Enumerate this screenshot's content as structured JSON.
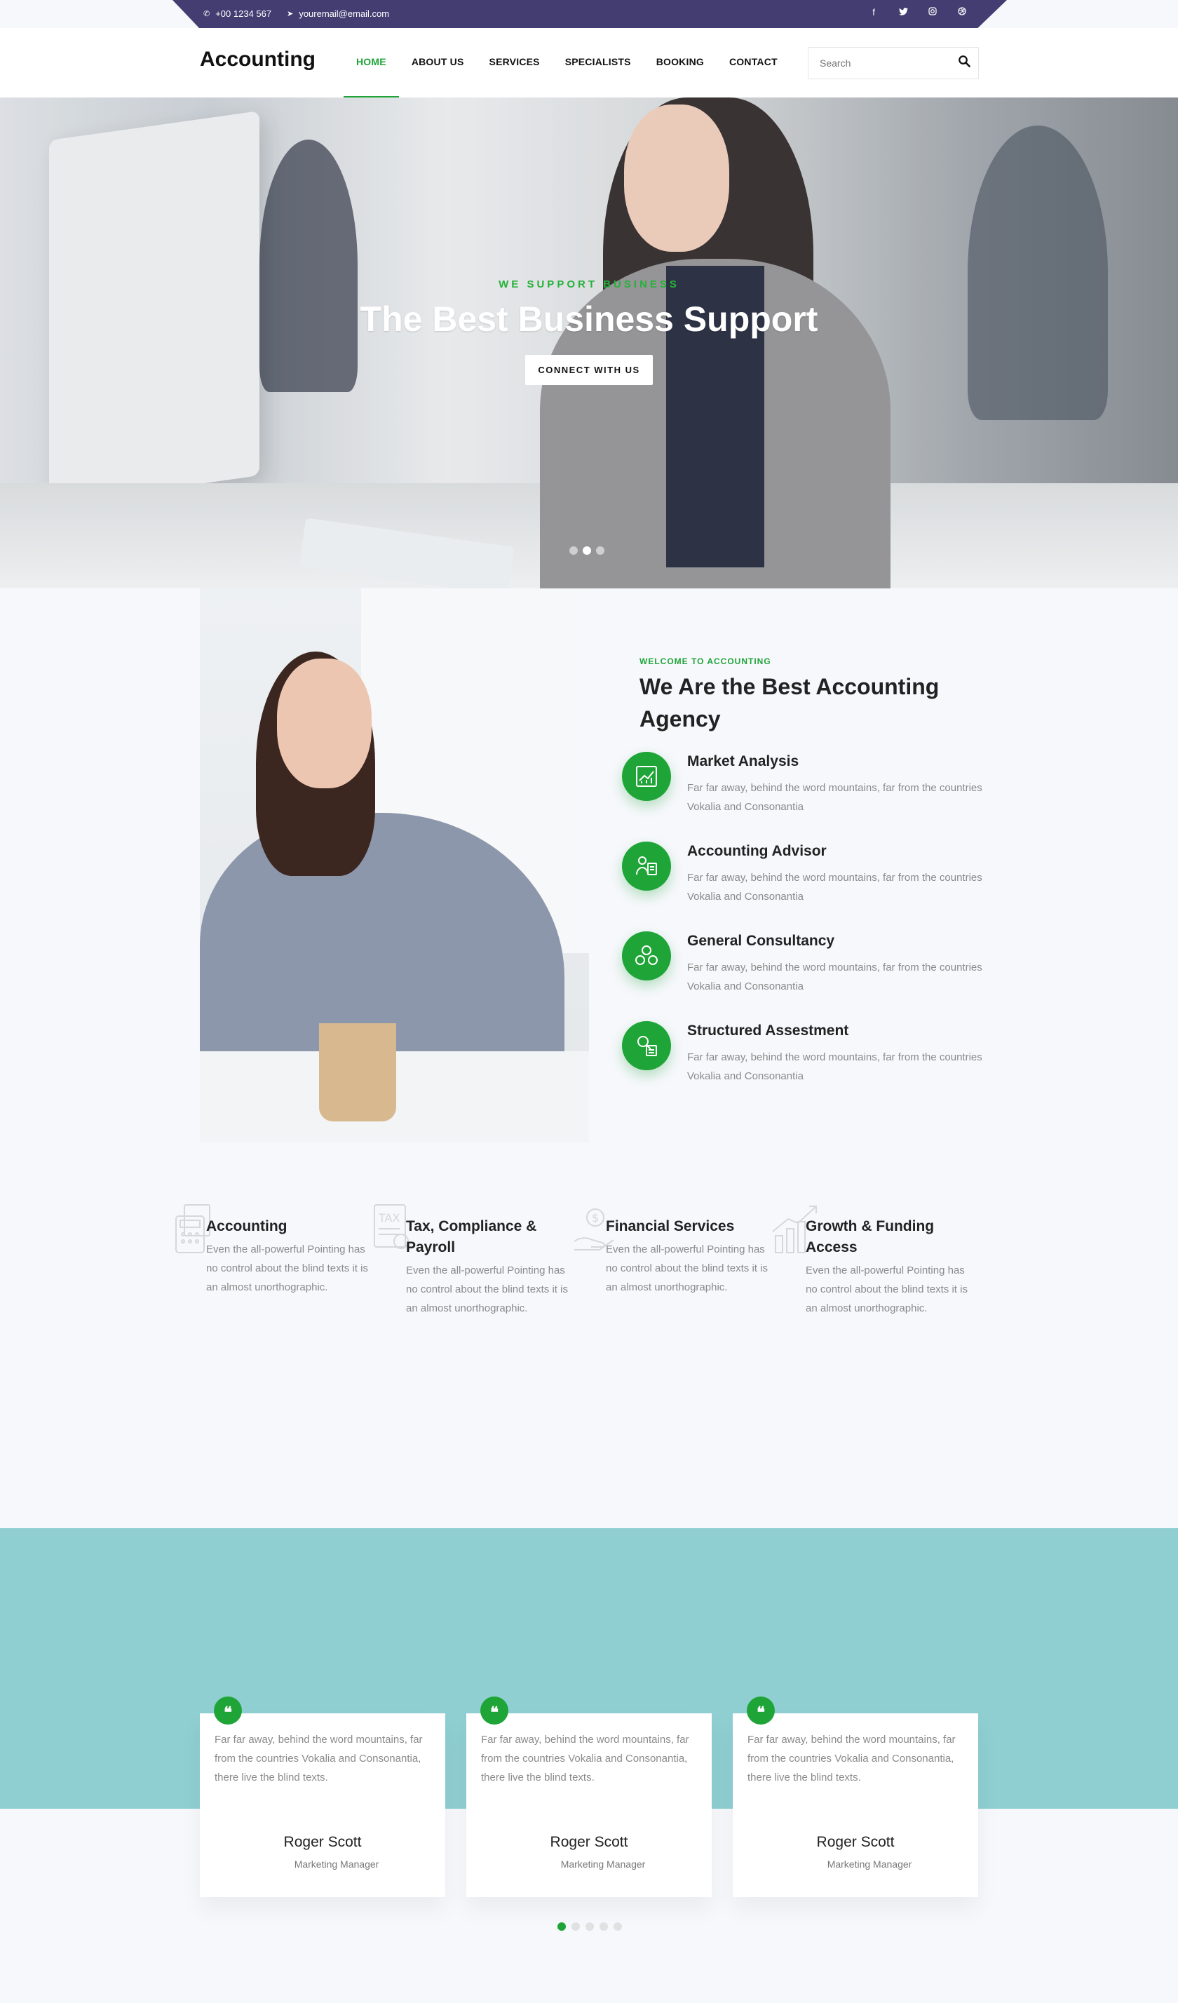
{
  "topbar": {
    "phone": "+00 1234 567",
    "email": "youremail@email.com",
    "social": [
      "f",
      "t",
      "ig",
      "dr"
    ]
  },
  "nav": {
    "brand": "Accounting",
    "items": [
      "HOME",
      "ABOUT US",
      "SERVICES",
      "SPECIALISTS",
      "BOOKING",
      "CONTACT"
    ],
    "active": "HOME",
    "search_placeholder": "Search"
  },
  "hero": {
    "kicker": "WE SUPPORT BUSINESS",
    "title": "The Best Business Support",
    "cta": "CONNECT WITH US",
    "slides": 3,
    "active_slide": 2
  },
  "about": {
    "kicker": "WELCOME TO ACCOUNTING",
    "title": "We Are the Best Accounting Agency",
    "features": [
      {
        "title": "Market Analysis",
        "icon": "chart-growth-icon",
        "text": "Far far away, behind the word mountains, far from the countries Vokalia and Consonantia"
      },
      {
        "title": "Accounting Advisor",
        "icon": "advisor-icon",
        "text": "Far far away, behind the word mountains, far from the countries Vokalia and Consonantia"
      },
      {
        "title": "General Consultancy",
        "icon": "team-icon",
        "text": "Far far away, behind the word mountains, far from the countries Vokalia and Consonantia"
      },
      {
        "title": "Structured Assestment",
        "icon": "assessment-icon",
        "text": "Far far away, behind the word mountains, far from the countries Vokalia and Consonantia"
      }
    ]
  },
  "services": [
    {
      "title": "Accounting",
      "icon": "calculator-icon",
      "text": "Even the all-powerful Pointing has no control about the blind texts it is an almost unorthographic."
    },
    {
      "title": "Tax, Compliance & Payroll",
      "icon": "tax-document-icon",
      "text": "Even the all-powerful Pointing has no control about the blind texts it is an almost unorthographic."
    },
    {
      "title": "Financial Services",
      "icon": "money-hand-icon",
      "text": "Even the all-powerful Pointing has no control about the blind texts it is an almost unorthographic."
    },
    {
      "title": "Growth & Funding Access",
      "icon": "growth-chart-icon",
      "text": "Even the all-powerful Pointing has no control about the blind texts it is an almost unorthographic."
    }
  ],
  "testimonials": {
    "items": [
      {
        "text": "Far far away, behind the word mountains, far from the countries Vokalia and Consonantia, there live the blind texts.",
        "name": "Roger Scott",
        "role": "Marketing Manager"
      },
      {
        "text": "Far far away, behind the word mountains, far from the countries Vokalia and Consonantia, there live the blind texts.",
        "name": "Roger Scott",
        "role": "Marketing Manager"
      },
      {
        "text": "Far far away, behind the word mountains, far from the countries Vokalia and Consonantia, there live the blind texts.",
        "name": "Roger Scott",
        "role": "Marketing Manager"
      }
    ],
    "pages": 5,
    "active_page": 1
  },
  "colors": {
    "accent": "#1fa437",
    "topbar": "#433d72",
    "teal": "#8fcfd1",
    "background": "#f7f8fc"
  }
}
